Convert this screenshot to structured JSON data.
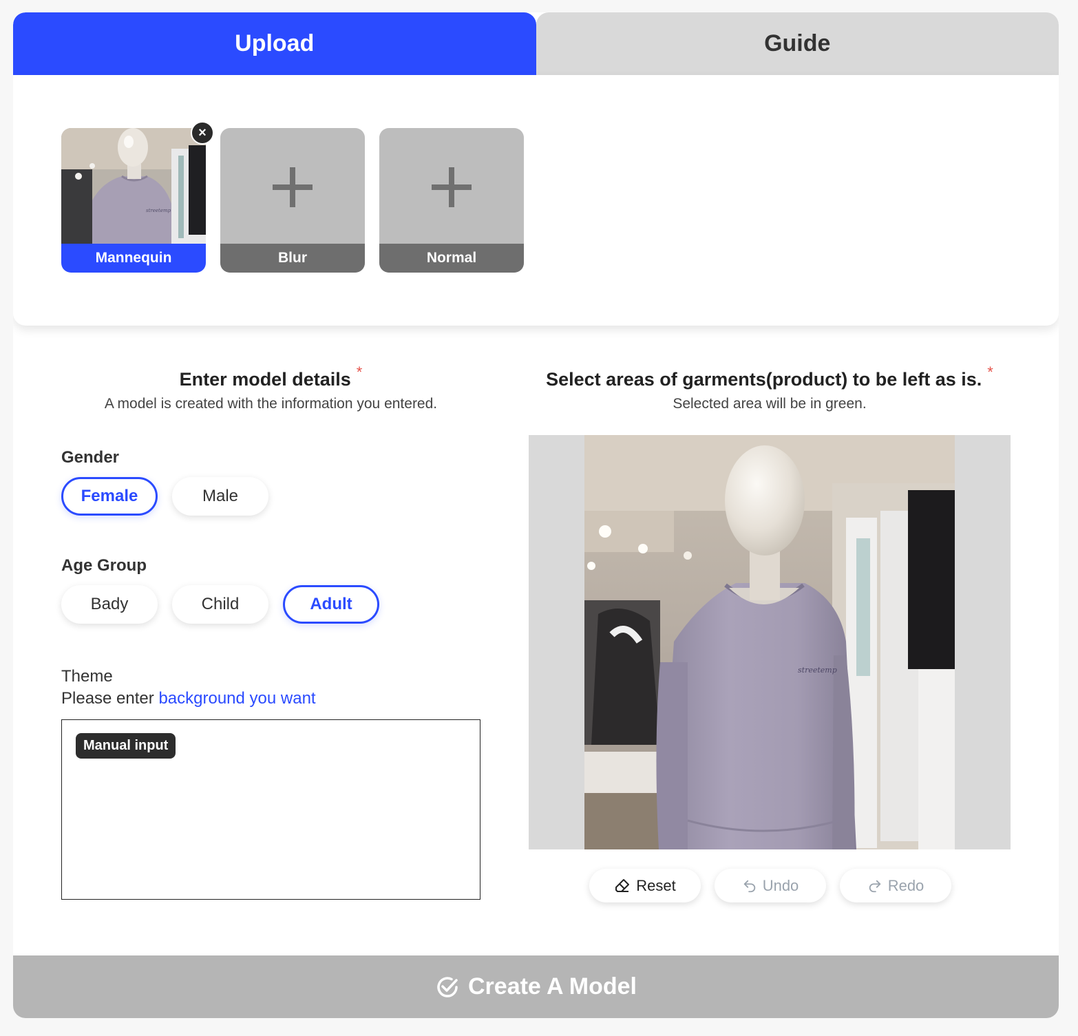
{
  "tabs": [
    {
      "label": "Upload",
      "active": true
    },
    {
      "label": "Guide",
      "active": false
    }
  ],
  "upload": {
    "slots": [
      {
        "label": "Mannequin",
        "filled": true
      },
      {
        "label": "Blur",
        "filled": false
      },
      {
        "label": "Normal",
        "filled": false
      }
    ],
    "remove_glyph": "×"
  },
  "model_details": {
    "title": "Enter model details",
    "required_mark": "*",
    "subtitle": "A model is created with the information you entered.",
    "gender": {
      "label": "Gender",
      "options": [
        "Female",
        "Male"
      ],
      "selected": "Female"
    },
    "age_group": {
      "label": "Age Group",
      "options": [
        "Bady",
        "Child",
        "Adult"
      ],
      "selected": "Adult"
    },
    "theme": {
      "label": "Theme",
      "prompt_prefix": "Please enter",
      "prompt_link": "background you want",
      "chip": "Manual input"
    }
  },
  "selection": {
    "title": "Select areas of garments(product) to be left as is.",
    "required_mark": "*",
    "subtitle": "Selected area will be in green.",
    "tools": [
      {
        "label": "Reset",
        "icon": "eraser-icon",
        "enabled": true
      },
      {
        "label": "Undo",
        "icon": "undo-icon",
        "enabled": false
      },
      {
        "label": "Redo",
        "icon": "redo-icon",
        "enabled": false
      }
    ]
  },
  "create_button": {
    "label": "Create A Model",
    "icon": "check-circle-icon"
  },
  "colors": {
    "accent": "#2b4bff",
    "tab_inactive": "#d9d9d9",
    "create_disabled": "#b5b5b5",
    "required": "#e5534b"
  }
}
